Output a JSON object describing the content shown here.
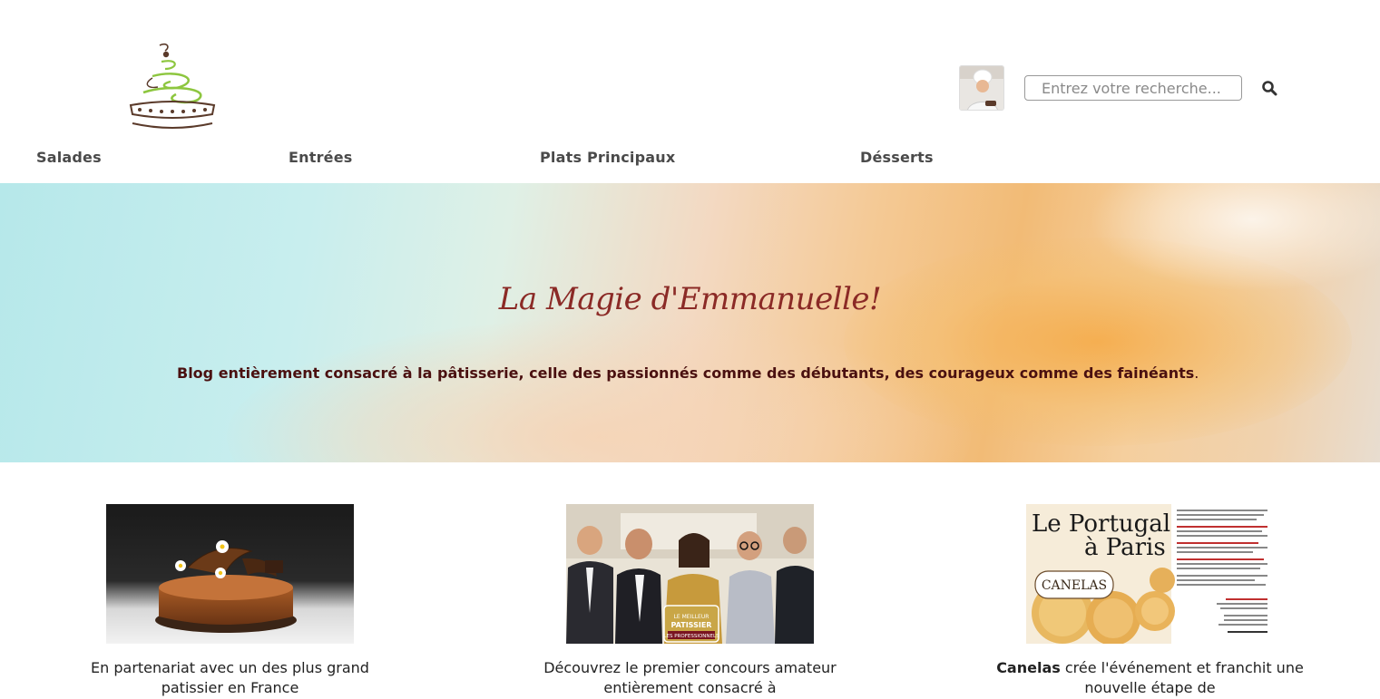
{
  "header": {
    "logo_icon": "cake-stand-logo",
    "avatar_icon": "chef-avatar",
    "search": {
      "placeholder": "Entrez votre recherche...",
      "button_icon": "search-icon"
    }
  },
  "nav": {
    "items": [
      {
        "label": "Salades"
      },
      {
        "label": "Entrées"
      },
      {
        "label": "Plats Principaux"
      },
      {
        "label": "Désserts"
      }
    ]
  },
  "hero": {
    "title": "La Magie d'Emmanuelle!",
    "subtitle": "Blog entièrement consacré à la pâtisserie, celle des passionnés comme des débutants, des courageux comme des fainéants",
    "subtitle_end": "."
  },
  "cards": [
    {
      "image": "chocolate-cake-photo",
      "text": "En partenariat avec un des plus grand patissier en France"
    },
    {
      "image": "meilleur-patissier-jury-photo",
      "badge_text": "LE MEILLEUR PATISSIER LES PROFESSIONNELS",
      "text": "Découvrez le premier concours amateur entièrement consacré à"
    },
    {
      "image": "portugal-paris-canelas-ad",
      "ad_title": "Le Portugal à Paris",
      "ad_brand": "CANELAS",
      "text_bold": "Canelas",
      "text": " crée l'événement et franchit une nouvelle étape de"
    }
  ],
  "colors": {
    "nav_text": "#4a4a4a",
    "hero_title": "#8b2a26",
    "hero_sub": "#4a1010",
    "logo_green": "#8dc63f",
    "logo_brown": "#5a3a2a"
  }
}
